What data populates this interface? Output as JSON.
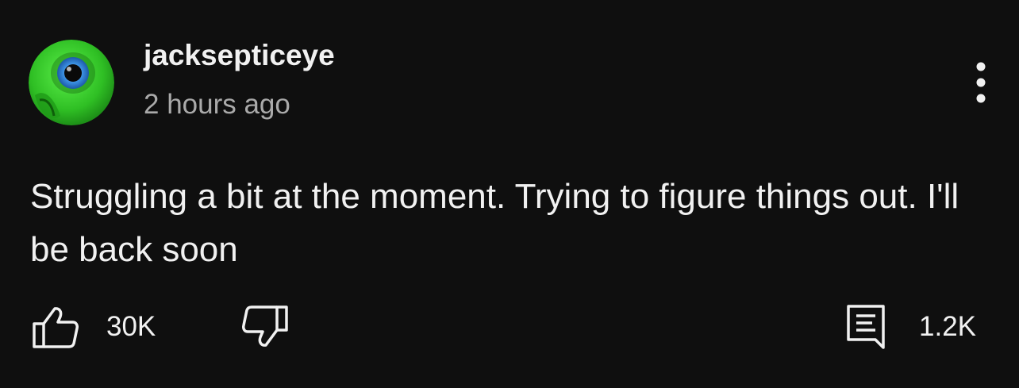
{
  "post": {
    "author": "jacksepticeye",
    "timestamp": "2 hours ago",
    "text": "Struggling a bit at the moment. Trying to figure things out. I'll be back soon",
    "likes": "30K",
    "comments": "1.2K"
  },
  "icons": {
    "avatar": "septic-eye-logo",
    "more": "more-vertical-icon",
    "like": "thumbs-up-icon",
    "dislike": "thumbs-down-icon",
    "comments": "comment-icon"
  },
  "colors": {
    "background": "#0f0f0f",
    "text": "#f1f1f1",
    "muted": "#aaaaaa",
    "avatar_green": "#3ecf2f"
  }
}
